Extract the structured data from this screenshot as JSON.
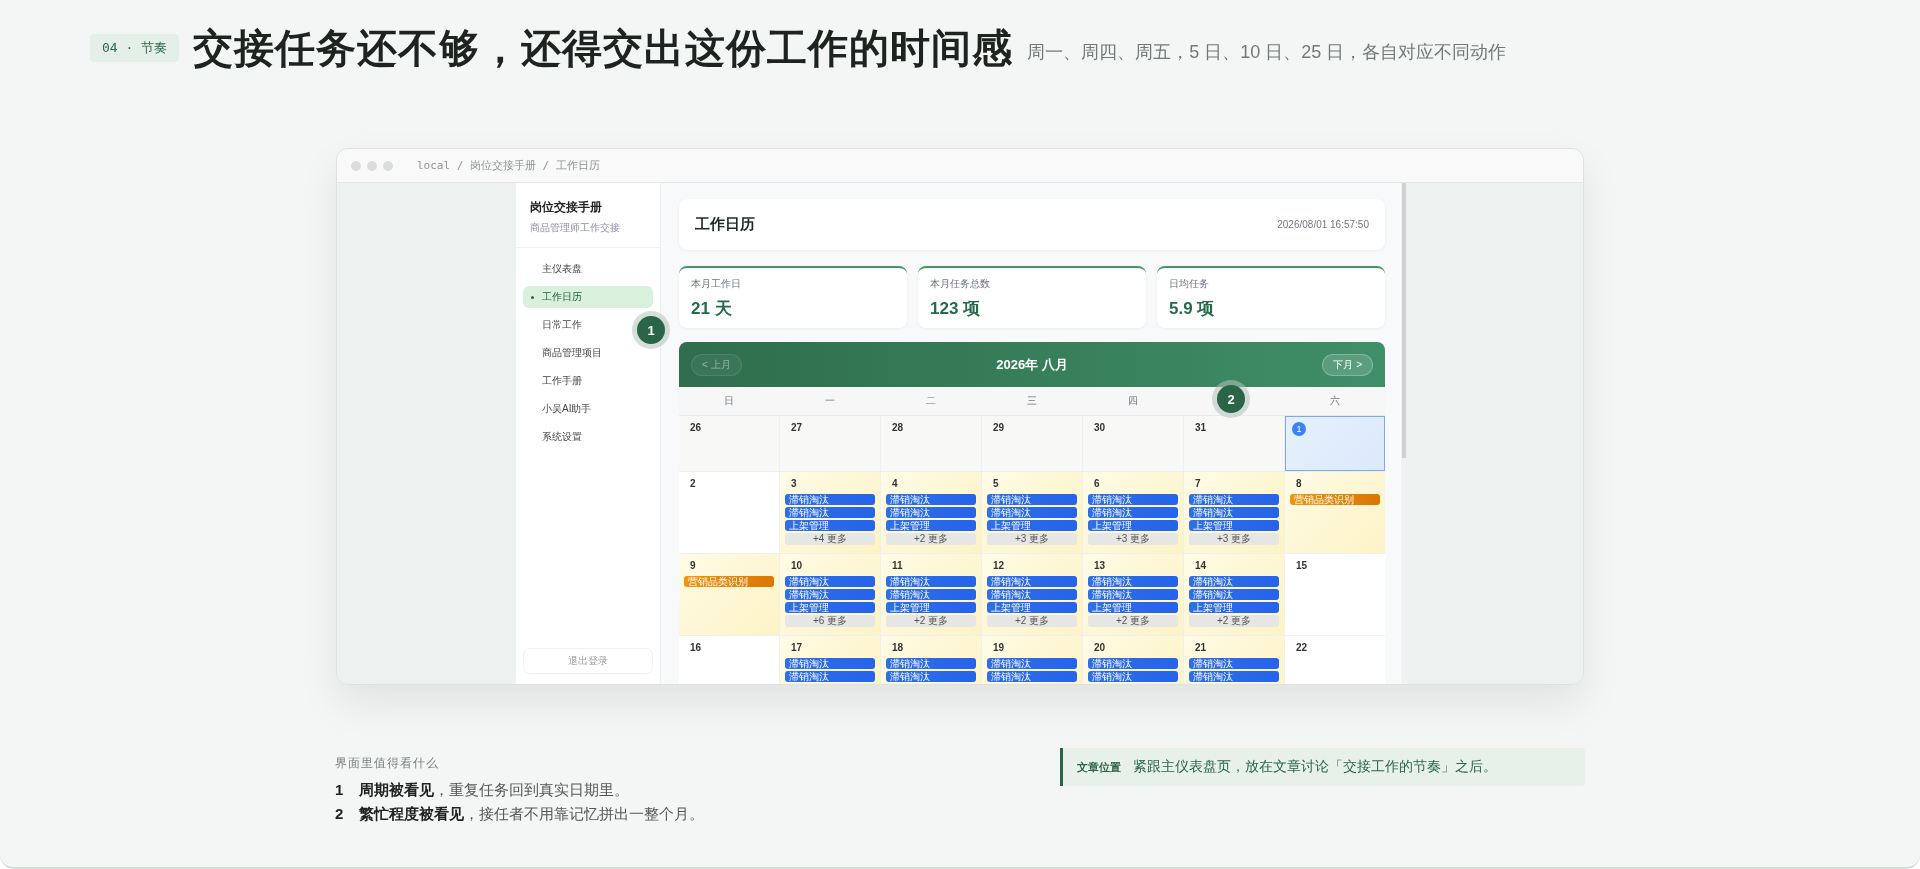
{
  "section_tag": "04 · 节奏",
  "headline": "交接任务还不够，还得交出这份工作的时间感",
  "subheadline": "周一、周四、周五，5 日、10 日、25 日，各自对应不同动作",
  "browser": {
    "breadcrumb": "local / 岗位交接手册 / 工作日历"
  },
  "sidebar": {
    "title": "岗位交接手册",
    "subtitle": "商品管理师工作交接",
    "items": [
      {
        "label": "主仪表盘",
        "selected": false
      },
      {
        "label": "工作日历",
        "selected": true
      },
      {
        "label": "日常工作",
        "selected": false
      },
      {
        "label": "商品管理项目",
        "selected": false
      },
      {
        "label": "工作手册",
        "selected": false
      },
      {
        "label": "小吴AI助手",
        "selected": false
      },
      {
        "label": "系统设置",
        "selected": false
      }
    ],
    "logout": "退出登录"
  },
  "page_header": {
    "title": "工作日历",
    "timestamp": "2026/08/01 16:57:50"
  },
  "stats": [
    {
      "label": "本月工作日",
      "value": "21 天"
    },
    {
      "label": "本月任务总数",
      "value": "123 项"
    },
    {
      "label": "日均任务",
      "value": "5.9 项"
    }
  ],
  "calendar": {
    "prev": "< 上月",
    "title": "2026年 八月",
    "next": "下月 >",
    "weekdays": [
      "日",
      "一",
      "二",
      "三",
      "四",
      "六"
    ],
    "weeks": [
      [
        {
          "day": "26",
          "kind": "outside"
        },
        {
          "day": "27",
          "kind": "outside"
        },
        {
          "day": "28",
          "kind": "outside"
        },
        {
          "day": "29",
          "kind": "outside"
        },
        {
          "day": "30",
          "kind": "outside"
        },
        {
          "day": "31",
          "kind": "outside"
        },
        {
          "day": "1",
          "kind": "today"
        }
      ],
      [
        {
          "day": "2",
          "kind": "free"
        },
        {
          "day": "3",
          "kind": "busy",
          "events": [
            {
              "label": "滞销淘汰",
              "kind": "task"
            },
            {
              "label": "滞销淘汰",
              "kind": "task"
            },
            {
              "label": "上架管理",
              "kind": "task"
            }
          ],
          "more": "+4 更多"
        },
        {
          "day": "4",
          "kind": "busy",
          "events": [
            {
              "label": "滞销淘汰",
              "kind": "task"
            },
            {
              "label": "滞销淘汰",
              "kind": "task"
            },
            {
              "label": "上架管理",
              "kind": "task"
            }
          ],
          "more": "+2 更多"
        },
        {
          "day": "5",
          "kind": "busy",
          "events": [
            {
              "label": "滞销淘汰",
              "kind": "task"
            },
            {
              "label": "滞销淘汰",
              "kind": "task"
            },
            {
              "label": "上架管理",
              "kind": "task"
            }
          ],
          "more": "+3 更多"
        },
        {
          "day": "6",
          "kind": "busy",
          "events": [
            {
              "label": "滞销淘汰",
              "kind": "task"
            },
            {
              "label": "滞销淘汰",
              "kind": "task"
            },
            {
              "label": "上架管理",
              "kind": "task"
            }
          ],
          "more": "+3 更多"
        },
        {
          "day": "7",
          "kind": "busy",
          "events": [
            {
              "label": "滞销淘汰",
              "kind": "task"
            },
            {
              "label": "滞销淘汰",
              "kind": "task"
            },
            {
              "label": "上架管理",
              "kind": "task"
            }
          ],
          "more": "+3 更多"
        },
        {
          "day": "8",
          "kind": "busy",
          "events": [
            {
              "label": "营销品类识别",
              "kind": "marketing"
            }
          ]
        }
      ],
      [
        {
          "day": "9",
          "kind": "busy",
          "events": [
            {
              "label": "营销品类识别",
              "kind": "marketing"
            }
          ]
        },
        {
          "day": "10",
          "kind": "busy",
          "events": [
            {
              "label": "滞销淘汰",
              "kind": "task"
            },
            {
              "label": "滞销淘汰",
              "kind": "task"
            },
            {
              "label": "上架管理",
              "kind": "task"
            }
          ],
          "more": "+6 更多"
        },
        {
          "day": "11",
          "kind": "busy",
          "events": [
            {
              "label": "滞销淘汰",
              "kind": "task"
            },
            {
              "label": "滞销淘汰",
              "kind": "task"
            },
            {
              "label": "上架管理",
              "kind": "task"
            }
          ],
          "more": "+2 更多"
        },
        {
          "day": "12",
          "kind": "busy",
          "events": [
            {
              "label": "滞销淘汰",
              "kind": "task"
            },
            {
              "label": "滞销淘汰",
              "kind": "task"
            },
            {
              "label": "上架管理",
              "kind": "task"
            }
          ],
          "more": "+2 更多"
        },
        {
          "day": "13",
          "kind": "busy",
          "events": [
            {
              "label": "滞销淘汰",
              "kind": "task"
            },
            {
              "label": "滞销淘汰",
              "kind": "task"
            },
            {
              "label": "上架管理",
              "kind": "task"
            }
          ],
          "more": "+2 更多"
        },
        {
          "day": "14",
          "kind": "busy",
          "events": [
            {
              "label": "滞销淘汰",
              "kind": "task"
            },
            {
              "label": "滞销淘汰",
              "kind": "task"
            },
            {
              "label": "上架管理",
              "kind": "task"
            }
          ],
          "more": "+2 更多"
        },
        {
          "day": "15",
          "kind": "free"
        }
      ],
      [
        {
          "day": "16",
          "kind": "free"
        },
        {
          "day": "17",
          "kind": "busy",
          "events": [
            {
              "label": "滞销淘汰",
              "kind": "task"
            },
            {
              "label": "滞销淘汰",
              "kind": "task"
            }
          ]
        },
        {
          "day": "18",
          "kind": "busy",
          "events": [
            {
              "label": "滞销淘汰",
              "kind": "task"
            },
            {
              "label": "滞销淘汰",
              "kind": "task"
            }
          ]
        },
        {
          "day": "19",
          "kind": "busy",
          "events": [
            {
              "label": "滞销淘汰",
              "kind": "task"
            },
            {
              "label": "滞销淘汰",
              "kind": "task"
            }
          ]
        },
        {
          "day": "20",
          "kind": "busy",
          "events": [
            {
              "label": "滞销淘汰",
              "kind": "task"
            },
            {
              "label": "滞销淘汰",
              "kind": "task"
            }
          ]
        },
        {
          "day": "21",
          "kind": "busy",
          "events": [
            {
              "label": "滞销淘汰",
              "kind": "task"
            },
            {
              "label": "滞销淘汰",
              "kind": "task"
            }
          ]
        },
        {
          "day": "22",
          "kind": "free"
        }
      ]
    ]
  },
  "callouts": [
    "1",
    "2"
  ],
  "notes": {
    "heading": "界面里值得看什么",
    "items": [
      {
        "number": "1",
        "text": "**周期被看见**，重复任务回到真实日期里。"
      },
      {
        "number": "2",
        "text": "**繁忙程度被看见**，接任者不用靠记忆拼出一整个月。"
      }
    ]
  },
  "article_position": {
    "label": "文章位置",
    "text": "紧跟主仪表盘页，放在文章讨论「交接工作的节奏」之后。"
  }
}
